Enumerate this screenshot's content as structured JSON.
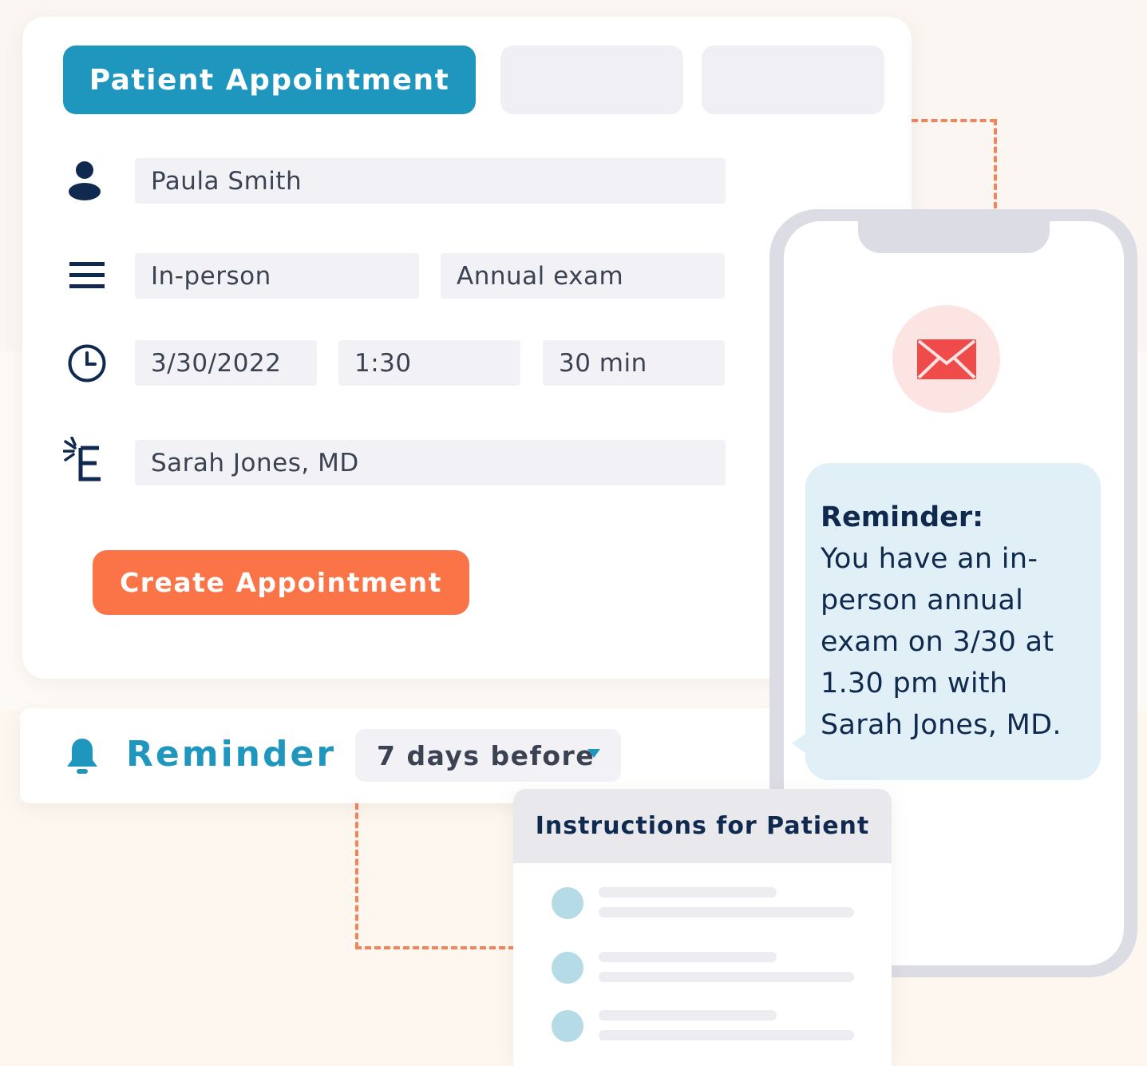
{
  "appointment": {
    "active_tab_label": "Patient Appointment",
    "patient_name": "Paula Smith",
    "visit_type": "In-person",
    "visit_reason": "Annual exam",
    "date": "3/30/2022",
    "time": "1:30",
    "duration": "30 min",
    "provider": "Sarah Jones, MD",
    "create_button_label": "Create Appointment"
  },
  "reminder": {
    "label": "Reminder",
    "selected_option": "7 days before"
  },
  "phone": {
    "message_heading": "Reminder:",
    "message_body": "You have an in-person annual exam on 3/30 at 1.30 pm with Sarah Jones, MD."
  },
  "instructions": {
    "title": "Instructions for Patient"
  },
  "colors": {
    "primary": "#1e96bd",
    "accent": "#fb7447",
    "navy": "#0f2a4e"
  }
}
